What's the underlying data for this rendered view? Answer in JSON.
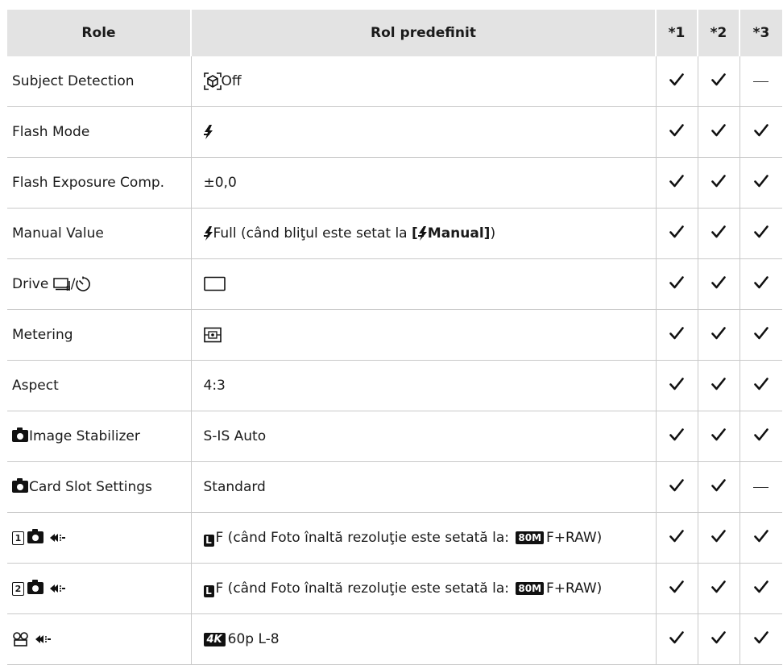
{
  "header": {
    "role": "Role",
    "default": "Rol predefinit",
    "m1": "*1",
    "m2": "*2",
    "m3": "*3"
  },
  "rows": [
    {
      "role": "Subject Detection",
      "default": "Off",
      "marks": [
        "check",
        "check",
        "dash"
      ]
    },
    {
      "role": "Flash Mode",
      "default": "",
      "marks": [
        "check",
        "check",
        "check"
      ]
    },
    {
      "role": "Flash Exposure Comp.",
      "default": "±0,0",
      "marks": [
        "check",
        "check",
        "check"
      ]
    },
    {
      "role": "Manual Value",
      "default_pre": "Full (când bliţul este setat la ",
      "default_bold": "Manual]",
      "default_bold_open": "[",
      "default_post": ")",
      "marks": [
        "check",
        "check",
        "check"
      ]
    },
    {
      "role": "Drive",
      "role_sep": "/",
      "default": "",
      "marks": [
        "check",
        "check",
        "check"
      ]
    },
    {
      "role": "Metering",
      "default": "",
      "marks": [
        "check",
        "check",
        "check"
      ]
    },
    {
      "role": "Aspect",
      "default": "4:3",
      "marks": [
        "check",
        "check",
        "check"
      ]
    },
    {
      "role": "Image Stabilizer",
      "default": "S-IS Auto",
      "marks": [
        "check",
        "check",
        "check"
      ]
    },
    {
      "role": "Card Slot Settings",
      "default": "Standard",
      "marks": [
        "check",
        "check",
        "dash"
      ]
    },
    {
      "role_num": "1",
      "l_letter": "L",
      "default_pre": "F (când Foto înaltă rezoluţie este setată la: ",
      "badge": "80M",
      "default_post": "F+RAW)",
      "marks": [
        "check",
        "check",
        "check"
      ]
    },
    {
      "role_num": "2",
      "l_letter": "L",
      "default_pre": "F (când Foto înaltă rezoluţie este setată la: ",
      "badge": "80M",
      "default_post": "F+RAW)",
      "marks": [
        "check",
        "check",
        "check"
      ]
    },
    {
      "badge4k": "4K",
      "default": "60p L-8",
      "marks": [
        "check",
        "check",
        "check"
      ]
    }
  ],
  "icons": {
    "check": "check-icon",
    "dash": "dash-icon",
    "camera": "camera-icon",
    "flash": "flash-icon",
    "subject": "subject-detection-icon",
    "sequential": "sequential-shooting-icon",
    "timer": "self-timer-icon",
    "single": "single-frame-icon",
    "metering": "metering-icon",
    "quality": "image-quality-icon",
    "movie": "movie-icon"
  }
}
